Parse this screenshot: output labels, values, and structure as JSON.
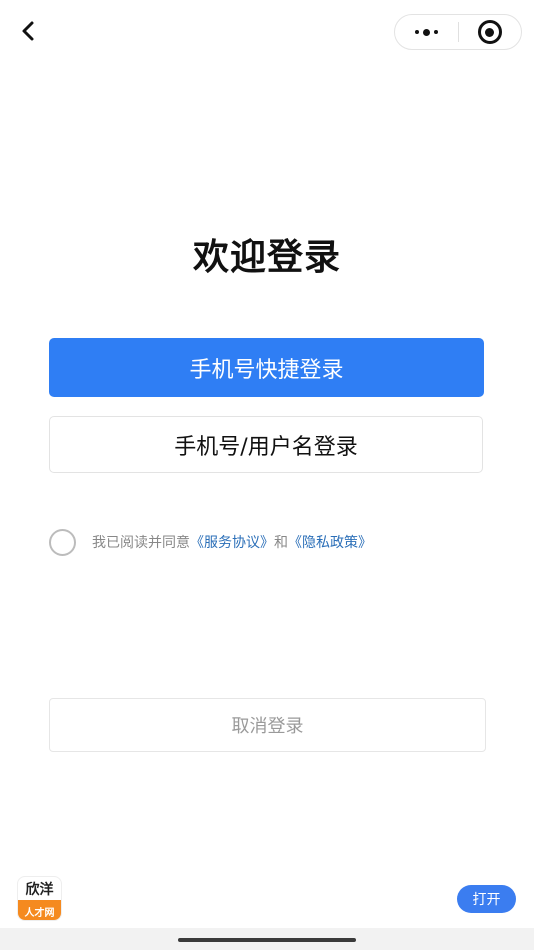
{
  "nav": {
    "back_icon": "chevron-left-icon",
    "more_icon": "more-dots-icon",
    "close_icon": "target-close-icon"
  },
  "page": {
    "title": "欢迎登录"
  },
  "buttons": {
    "quick_login": "手机号快捷登录",
    "account_login": "手机号/用户名登录",
    "cancel_login": "取消登录"
  },
  "agreement": {
    "prefix": "我已阅读并同意",
    "service_link": "《服务协议》",
    "and": "和",
    "privacy_link": "《隐私政策》"
  },
  "footer": {
    "logo_top": "欣洋",
    "logo_bottom": "人才网",
    "open_button": "打开"
  },
  "colors": {
    "primary": "#2f7ef4",
    "link": "#2b6fb8",
    "logo_orange": "#f58a1f"
  }
}
